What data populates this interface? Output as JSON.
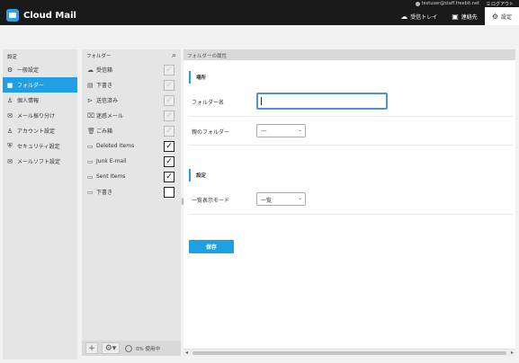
{
  "topbar": {
    "user_email": "testuser@staff.freebit.net",
    "logout_label": "ログアウト"
  },
  "header": {
    "app_name": "Cloud Mail",
    "nav": [
      {
        "label": "受信トレイ",
        "icon": "cloud-icon"
      },
      {
        "label": "連絡先",
        "icon": "contacts-icon"
      },
      {
        "label": "設定",
        "icon": "gear-icon",
        "active": true
      }
    ]
  },
  "settings_nav": {
    "title": "設定",
    "items": [
      {
        "label": "一般設定",
        "icon": "gear-icon"
      },
      {
        "label": "フォルダー",
        "icon": "folder-icon",
        "active": true
      },
      {
        "label": "個人情報",
        "icon": "person-icon"
      },
      {
        "label": "メール振り分け",
        "icon": "mail-filter-icon"
      },
      {
        "label": "アカウント設定",
        "icon": "account-icon"
      },
      {
        "label": "セキュリティ設定",
        "icon": "security-icon"
      },
      {
        "label": "メールソフト設定",
        "icon": "mail-client-icon"
      }
    ]
  },
  "folder_panel": {
    "title": "フォルダー",
    "folders": [
      {
        "label": "受信箱",
        "icon": "inbox-icon",
        "checked": true,
        "disabled": true
      },
      {
        "label": "下書き",
        "icon": "draft-icon",
        "checked": true,
        "disabled": true
      },
      {
        "label": "送信済み",
        "icon": "sent-icon",
        "checked": true,
        "disabled": true
      },
      {
        "label": "迷惑メール",
        "icon": "junk-icon",
        "checked": true,
        "disabled": true
      },
      {
        "label": "ごみ箱",
        "icon": "trash-icon",
        "checked": true,
        "disabled": true
      },
      {
        "label": "Deleted Items",
        "icon": "folder-icon",
        "checked": true,
        "disabled": false
      },
      {
        "label": "Junk E-mail",
        "icon": "folder-icon",
        "checked": true,
        "disabled": false
      },
      {
        "label": "Sent Items",
        "icon": "folder-icon",
        "checked": true,
        "disabled": false
      },
      {
        "label": "下書き",
        "icon": "folder-icon",
        "checked": false,
        "disabled": false
      }
    ],
    "usage_text": "0% 使用中"
  },
  "main": {
    "header_title": "フォルダーの属性",
    "section_location": "場所",
    "folder_name_label": "フォルダー名",
    "folder_name_value": "",
    "parent_folder_label": "親のフォルダー",
    "parent_folder_value": "---",
    "section_settings": "設定",
    "view_mode_label": "一覧表示モード",
    "view_mode_value": "一覧",
    "save_label": "保存"
  }
}
